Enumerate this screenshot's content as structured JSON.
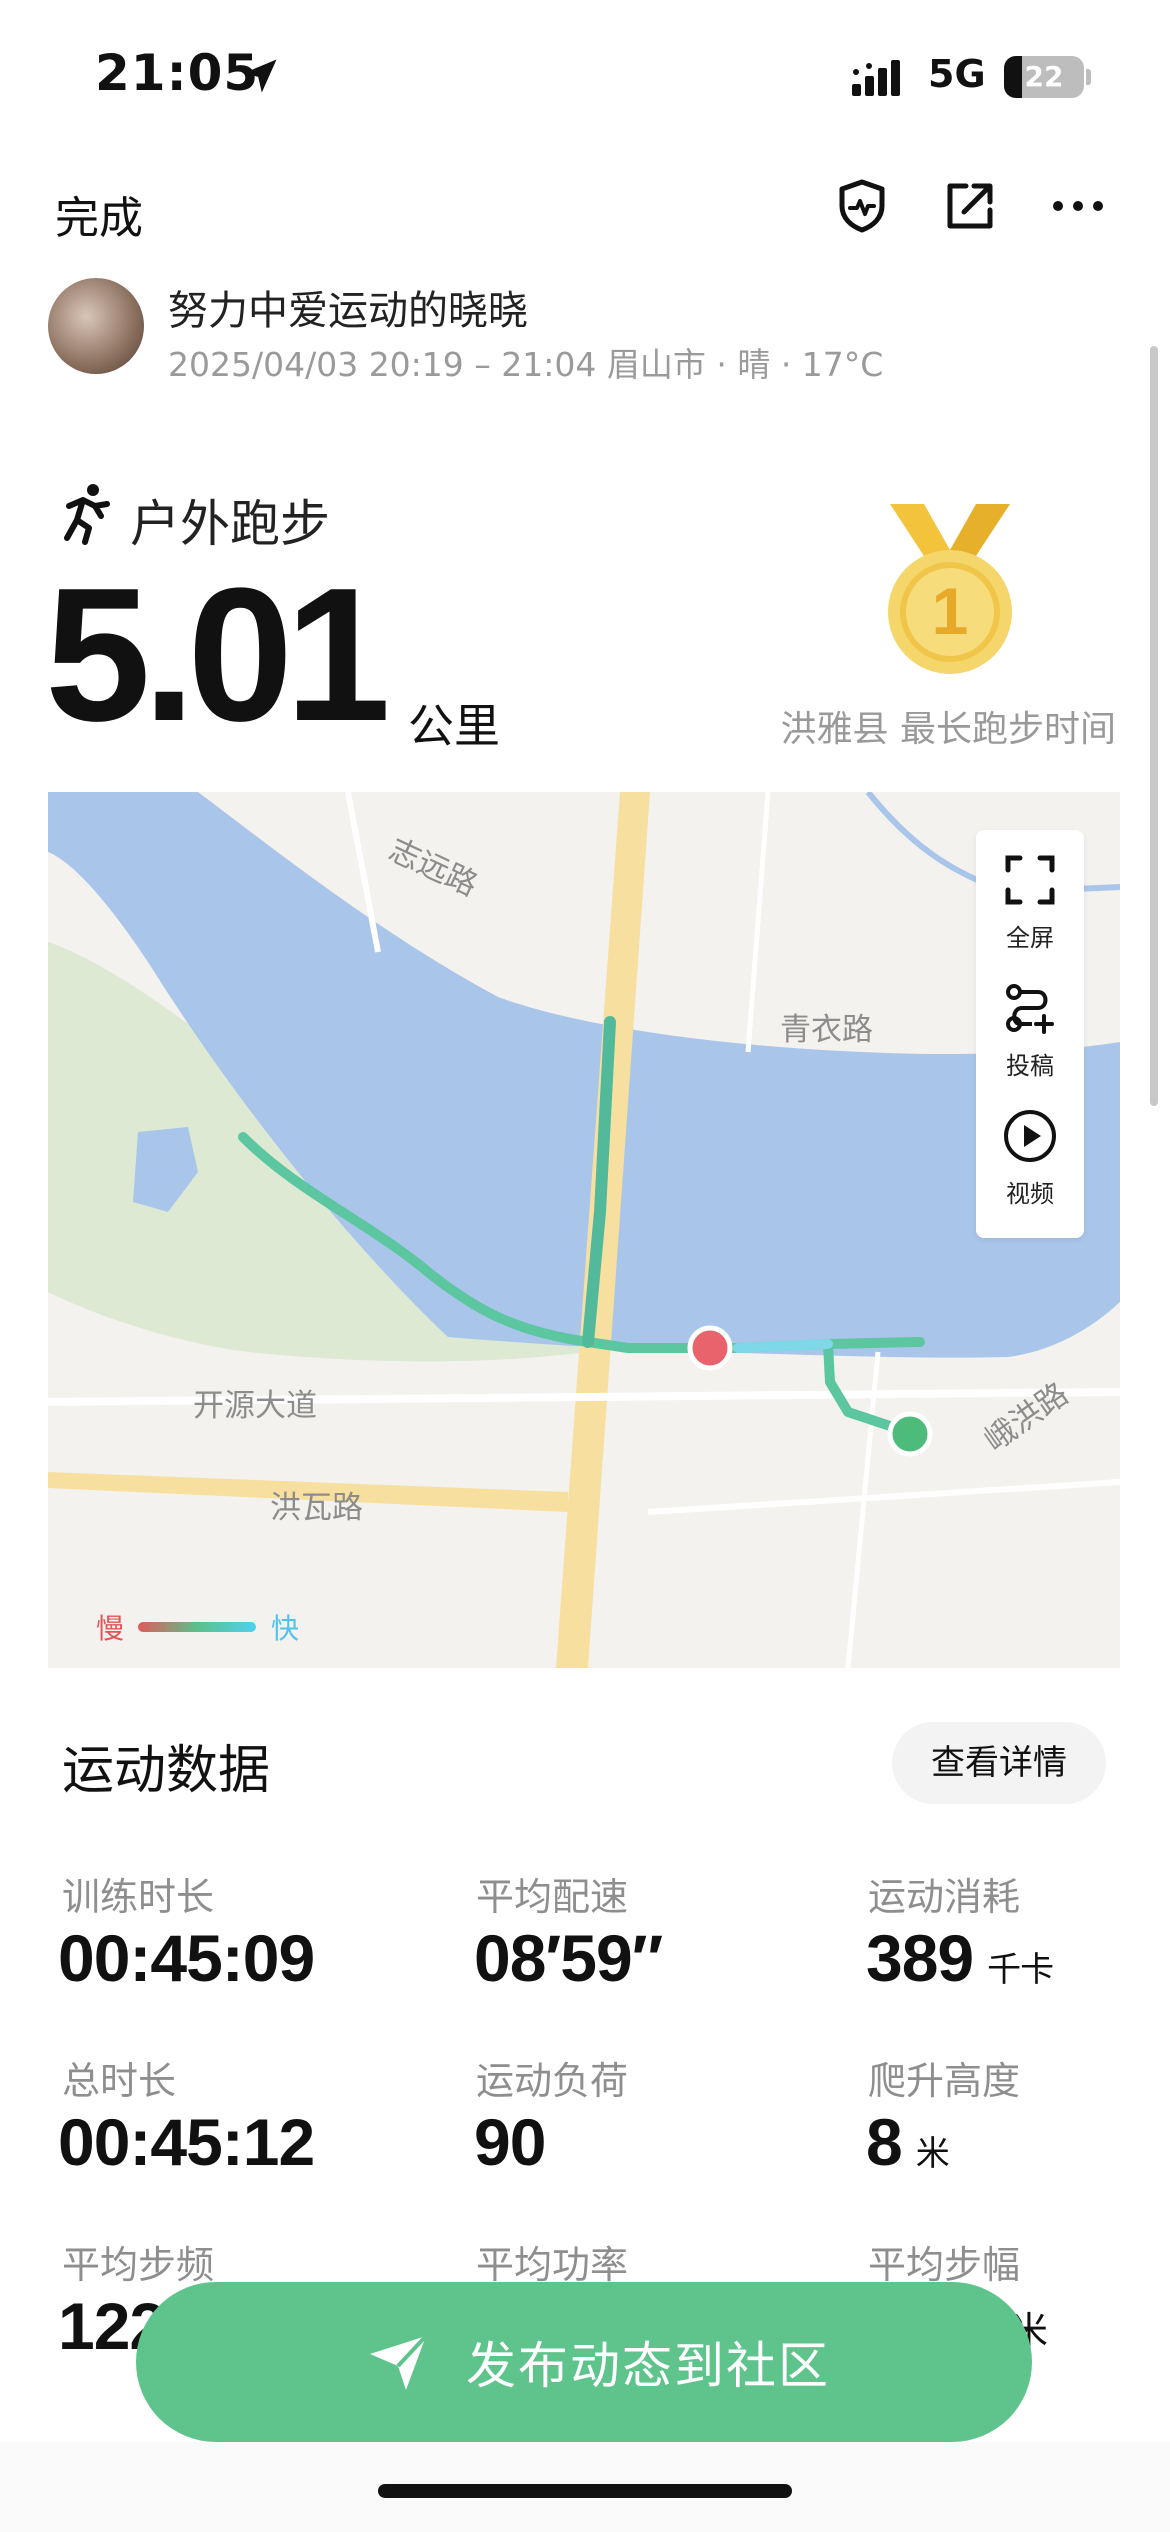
{
  "status_bar": {
    "time": "21:05",
    "network": "5G",
    "battery": "22"
  },
  "header": {
    "done_label": "完成",
    "icons": [
      "shield-heartbeat-icon",
      "share-icon",
      "more-icon"
    ]
  },
  "profile": {
    "name": "努力中爱运动的晓晓",
    "meta": "2025/04/03 20:19 – 21:04  眉山市 · 晴 · 17°C"
  },
  "workout": {
    "type": "户外跑步",
    "distance": "5.01",
    "unit": "公里",
    "achievement": "洪雅县 最长跑步时间",
    "medal_number": "1"
  },
  "map": {
    "labels": {
      "road1": "志远路",
      "road2": "青衣路",
      "road3": "开源大道",
      "road4": "洪瓦路",
      "road5": "峨洪路"
    },
    "tools": {
      "fullscreen": "全屏",
      "submit": "投稿",
      "video": "视频"
    },
    "legend": {
      "slow": "慢",
      "fast": "快"
    },
    "colors": {
      "water": "#a9c6ea",
      "park": "#dde9d3",
      "road": "#f7dfa0",
      "route": "#5cc6a0",
      "start": "#e8636c",
      "end": "#4dbb79"
    }
  },
  "data": {
    "title": "运动数据",
    "detail_button": "查看详情",
    "stats": [
      {
        "label": "训练时长",
        "value": "00:45:09",
        "unit": ""
      },
      {
        "label": "平均配速",
        "value": "08′59″",
        "unit": ""
      },
      {
        "label": "运动消耗",
        "value": "389",
        "unit": "千卡"
      },
      {
        "label": "总时长",
        "value": "00:45:12",
        "unit": ""
      },
      {
        "label": "运动负荷",
        "value": "90",
        "unit": ""
      },
      {
        "label": "爬升高度",
        "value": "8",
        "unit": "米"
      },
      {
        "label": "平均步频",
        "value": "122",
        "unit": ""
      },
      {
        "label": "平均功率",
        "value": "",
        "unit": ""
      },
      {
        "label": "平均步幅",
        "value": "",
        "unit": "米"
      }
    ]
  },
  "publish": {
    "label": "发布动态到社区"
  }
}
